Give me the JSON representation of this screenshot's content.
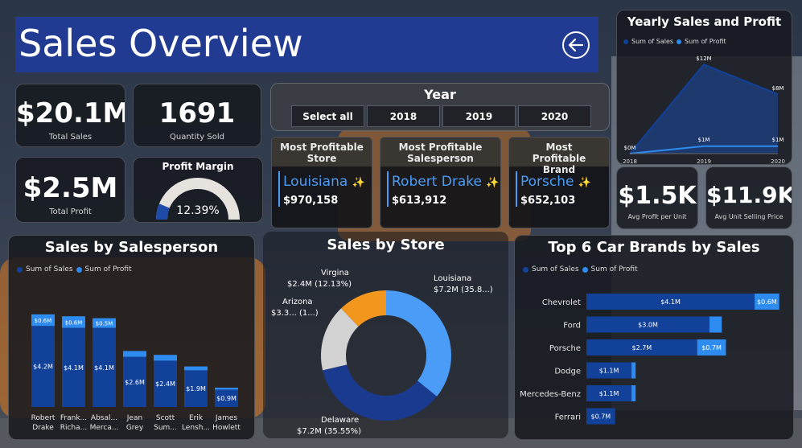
{
  "header": {
    "title": "Sales Overview",
    "back_icon": "arrow-left-circle-icon"
  },
  "kpis": {
    "total_sales": {
      "value": "$20.1M",
      "label": "Total Sales"
    },
    "quantity_sold": {
      "value": "1691",
      "label": "Quantity Sold"
    },
    "total_profit": {
      "value": "$2.5M",
      "label": "Total Profit"
    },
    "profit_margin": {
      "title": "Profit Margin",
      "value": "12.39%",
      "fraction": 0.1239
    },
    "avg_profit_per_unit": {
      "value": "$1.5K",
      "label": "Avg Profit per Unit"
    },
    "avg_unit_selling_price": {
      "value": "$11.9K",
      "label": "Avg Unit Selling Price"
    }
  },
  "year_filter": {
    "title": "Year",
    "options": [
      "Select all",
      "2018",
      "2019",
      "2020"
    ]
  },
  "most_profitable": [
    {
      "title": "Most Profitable Store",
      "name": "Louisiana",
      "value": "$970,158",
      "icon": "sparkle-icon"
    },
    {
      "title": "Most Profitable Salesperson",
      "name": "Robert Drake",
      "value": "$613,912",
      "icon": "sparkle-icon"
    },
    {
      "title": "Most Profitable Brand",
      "name": "Porsche",
      "value": "$652,103",
      "icon": "sparkle-icon"
    }
  ],
  "colors": {
    "sales": "#12419a",
    "profit": "#2e8cf0",
    "navy": "#1a3a8f",
    "orange": "#f2961e",
    "grey": "#d2d2d2",
    "light_blue": "#4a9cf7"
  },
  "chart_data": [
    {
      "id": "yearly",
      "type": "area",
      "title": "Yearly Sales and Profit",
      "legend": [
        "Sum of Sales",
        "Sum of Profit"
      ],
      "categories": [
        "2018",
        "2019",
        "2020"
      ],
      "series": [
        {
          "name": "Sum of Sales",
          "values": [
            0,
            12,
            8
          ]
        },
        {
          "name": "Sum of Profit",
          "values": [
            0,
            1,
            1
          ]
        }
      ],
      "sales_labels": [
        "$0M",
        "$12M",
        "$8M"
      ],
      "profit_labels": [
        "",
        "$1M",
        "$1M"
      ],
      "ylim": [
        0,
        13
      ]
    },
    {
      "id": "salesperson",
      "type": "bar",
      "title": "Sales by Salesperson",
      "legend": [
        "Sum of Sales",
        "Sum of Profit"
      ],
      "categories": [
        "Robert Drake",
        "Frank... Richa...",
        "Absal... Merca...",
        "Jean Grey",
        "Scott Sum...",
        "Erik Lensh...",
        "James Howlett"
      ],
      "series": [
        {
          "name": "Sum of Sales",
          "values": [
            4.2,
            4.1,
            4.1,
            2.6,
            2.4,
            1.9,
            0.9
          ]
        },
        {
          "name": "Sum of Profit",
          "values": [
            0.6,
            0.6,
            0.5,
            0.3,
            0.3,
            0.2,
            0.1
          ]
        }
      ],
      "sales_labels": [
        "$4.2M",
        "$4.1M",
        "$4.1M",
        "$2.6M",
        "$2.4M",
        "$1.9M",
        "$0.9M"
      ],
      "profit_labels": [
        "$0.6M",
        "$0.6M",
        "$0.5M",
        "",
        "",
        "",
        ""
      ]
    },
    {
      "id": "store",
      "type": "pie",
      "title": "Sales by Store",
      "slices": [
        {
          "name": "Louisiana",
          "value": 35.8,
          "label": "$7.2M (35.8...)"
        },
        {
          "name": "Delaware",
          "value": 35.55,
          "label": "$7.2M (35.55%)"
        },
        {
          "name": "Arizona",
          "value": 16.52,
          "label": "$3.3... (1...)"
        },
        {
          "name": "Virgina",
          "value": 12.13,
          "label": "$2.4M (12.13%)"
        }
      ]
    },
    {
      "id": "brands",
      "type": "bar",
      "title": "Top 6 Car Brands by Sales",
      "legend": [
        "Sum of Sales",
        "Sum of Profit"
      ],
      "categories": [
        "Chevrolet",
        "Ford",
        "Porsche",
        "Dodge",
        "Mercedes-Benz",
        "Ferrari"
      ],
      "series": [
        {
          "name": "Sum of Sales",
          "values": [
            4.1,
            3.0,
            2.7,
            1.1,
            1.1,
            0.7
          ]
        },
        {
          "name": "Sum of Profit",
          "values": [
            0.6,
            0.3,
            0.7,
            0.1,
            0.1,
            0.0
          ]
        }
      ],
      "sales_labels": [
        "$4.1M",
        "$3.0M",
        "$2.7M",
        "$1.1M",
        "$1.1M",
        "$0.7M"
      ],
      "profit_labels": [
        "$0.6M",
        "",
        "$0.7M",
        "",
        "",
        ""
      ]
    }
  ]
}
